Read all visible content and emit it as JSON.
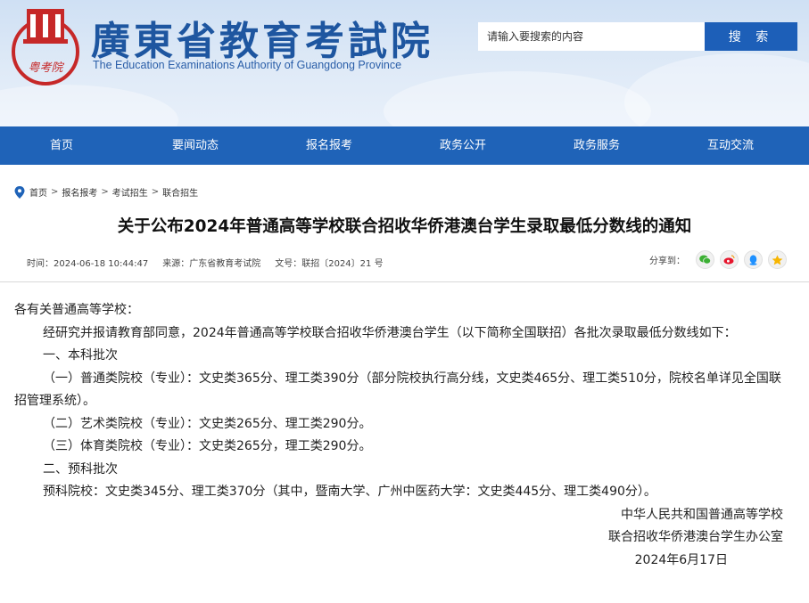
{
  "header": {
    "site_title": "廣東省教育考試院",
    "site_subtitle": "The Education Examinations Authority of Guangdong Province",
    "logo_text": "粤考院"
  },
  "search": {
    "placeholder": "请输入要搜索的内容",
    "button_label": "搜 索"
  },
  "nav": {
    "items": [
      "首页",
      "要闻动态",
      "报名报考",
      "政务公开",
      "政务服务",
      "互动交流"
    ]
  },
  "breadcrumb": {
    "items": [
      "首页",
      "报名报考",
      "考试招生",
      "联合招生"
    ],
    "separator": ">"
  },
  "article": {
    "title": "关于公布2024年普通高等学校联合招收华侨港澳台学生录取最低分数线的通知",
    "time": "时间：2024-06-18 10:44:47",
    "source": "来源：广东省教育考试院",
    "doc_no": "文号：联招〔2024〕21 号",
    "share_label": "分享到：",
    "greeting": "各有关普通高等学校：",
    "intro": "经研究并报请教育部同意，2024年普通高等学校联合招收华侨港澳台学生（以下简称全国联招）各批次录取最低分数线如下：",
    "section1": "一、本科批次",
    "item1": "（一）普通类院校（专业）：文史类365分、理工类390分（部分院校执行高分线，文史类465分、理工类510分，院校名单详见全国联招管理系统）。",
    "item2": "（二）艺术类院校（专业）：文史类265分、理工类290分。",
    "item3": "（三）体育类院校（专业）：文史类265分，理工类290分。",
    "section2": "二、预科批次",
    "item4": "预科院校：文史类345分、理工类370分（其中，暨南大学、广州中医药大学：文史类445分、理工类490分）。",
    "sign1": "中华人民共和国普通高等学校",
    "sign2": "联合招收华侨港澳台学生办公室",
    "date": "2024年6月17日"
  },
  "colors": {
    "nav_bg": "#1f63b8",
    "title_blue": "#1e56a0",
    "logo_red": "#c62828"
  },
  "icons": [
    "location-pin-icon",
    "wechat-icon",
    "weibo-icon",
    "qq-icon",
    "qzone-icon"
  ]
}
